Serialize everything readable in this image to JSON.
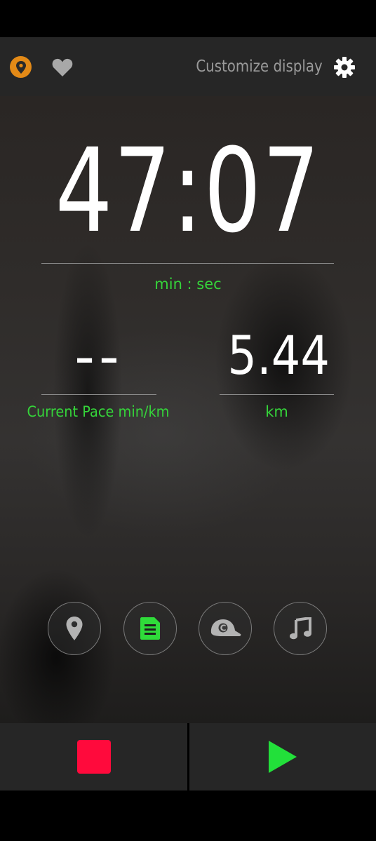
{
  "header": {
    "customize_label": "Customize display",
    "icons": {
      "location": "location-pin-icon",
      "favorite": "heart-icon",
      "settings": "gear-icon"
    },
    "location_color": "#e38a17"
  },
  "timer": {
    "value": "47:07",
    "unit": "min : sec"
  },
  "stats": [
    {
      "value": "--",
      "label": "Current Pace min/km"
    },
    {
      "value": "5.44",
      "label": "km"
    }
  ],
  "actions": [
    {
      "icon": "map-pin-icon"
    },
    {
      "icon": "notes-icon",
      "color": "#2fdc3a"
    },
    {
      "icon": "coach-cap-icon"
    },
    {
      "icon": "music-icon"
    }
  ],
  "controls": {
    "stop": {
      "icon": "stop-icon",
      "color": "#ff0a3c"
    },
    "play": {
      "icon": "play-icon",
      "color": "#22e03a"
    }
  },
  "colors": {
    "accent_green": "#35d43a"
  }
}
